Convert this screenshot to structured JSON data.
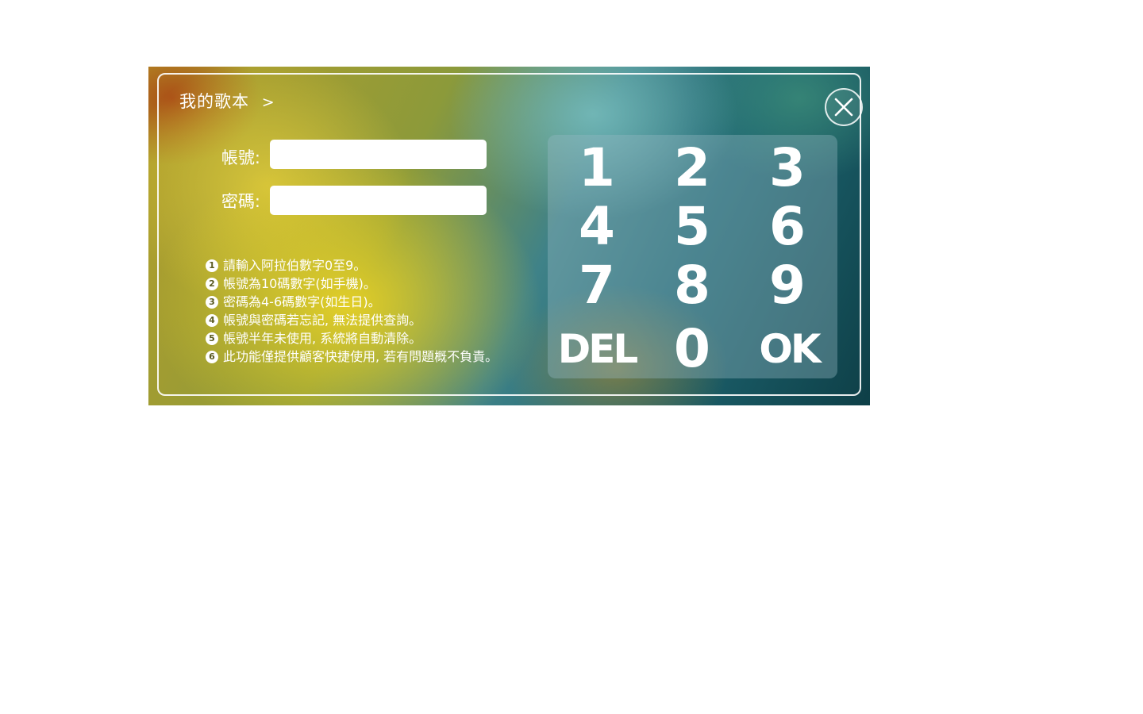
{
  "header": {
    "title": "我的歌本",
    "chevron": ">"
  },
  "close": {
    "icon": "close-icon"
  },
  "form": {
    "account_label": "帳號:",
    "account_value": "",
    "password_label": "密碼:",
    "password_value": ""
  },
  "notes": [
    {
      "num": "1",
      "text": "請輸入阿拉伯數字0至9。"
    },
    {
      "num": "2",
      "text": "帳號為10碼數字(如手機)。"
    },
    {
      "num": "3",
      "text": "密碼為4-6碼數字(如生日)。"
    },
    {
      "num": "4",
      "text": "帳號與密碼若忘記, 無法提供查詢。"
    },
    {
      "num": "5",
      "text": "帳號半年未使用, 系統將自動清除。"
    },
    {
      "num": "6",
      "text": "此功能僅提供顧客快捷使用, 若有問題概不負責。"
    }
  ],
  "keypad": {
    "keys": [
      "1",
      "2",
      "3",
      "4",
      "5",
      "6",
      "7",
      "8",
      "9",
      "DEL",
      "0",
      "OK"
    ]
  },
  "colors": {
    "text": "#ffffff",
    "frame": "#ffffff"
  }
}
